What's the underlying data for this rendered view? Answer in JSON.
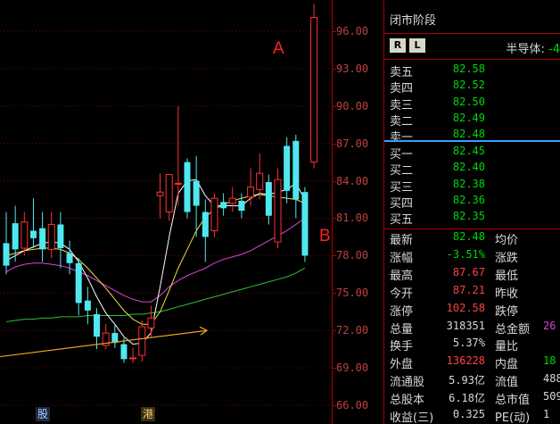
{
  "annotations": {
    "a": "A",
    "b": "B"
  },
  "axis": {
    "ticks": [
      "96.00",
      "93.00",
      "90.00",
      "87.00",
      "84.00",
      "81.00",
      "78.00",
      "75.00",
      "72.00",
      "69.00",
      "66.00"
    ]
  },
  "bottom_tags": {
    "left": "股",
    "right": "港"
  },
  "panel": {
    "title": "闭市阶段",
    "btn_r": "R",
    "btn_l": "L",
    "sector_name": "半导体:",
    "sector_change": "-4",
    "asks": [
      {
        "label": "卖五",
        "price": "82.58"
      },
      {
        "label": "卖四",
        "price": "82.52"
      },
      {
        "label": "卖三",
        "price": "82.50"
      },
      {
        "label": "卖二",
        "price": "82.49"
      },
      {
        "label": "卖一",
        "price": "82.48"
      }
    ],
    "bids": [
      {
        "label": "买一",
        "price": "82.45"
      },
      {
        "label": "买二",
        "price": "82.40"
      },
      {
        "label": "买三",
        "price": "82.38"
      },
      {
        "label": "买四",
        "price": "82.36"
      },
      {
        "label": "买五",
        "price": "82.35"
      }
    ],
    "stats": [
      {
        "l1": "最新",
        "v1": "82.48",
        "c1": "g",
        "l2": "均价",
        "v2": "",
        "c2": "w"
      },
      {
        "l1": "涨幅",
        "v1": "-3.51%",
        "c1": "g",
        "l2": "涨跌",
        "v2": "",
        "c2": "w"
      },
      {
        "l1": "最高",
        "v1": "87.67",
        "c1": "r",
        "l2": "最低",
        "v2": "",
        "c2": "w"
      },
      {
        "l1": "今开",
        "v1": "87.21",
        "c1": "r",
        "l2": "昨收",
        "v2": "",
        "c2": "w"
      },
      {
        "l1": "涨停",
        "v1": "102.58",
        "c1": "r",
        "l2": "跌停",
        "v2": "",
        "c2": "w"
      },
      {
        "l1": "总量",
        "v1": "318351",
        "c1": "w",
        "l2": "总金额",
        "v2": "26",
        "c2": "m"
      },
      {
        "l1": "换手",
        "v1": "5.37%",
        "c1": "w",
        "l2": "量比",
        "v2": "",
        "c2": "w"
      },
      {
        "l1": "外盘",
        "v1": "136228",
        "c1": "r",
        "l2": "内盘",
        "v2": "18",
        "c2": "g"
      },
      {
        "l1": "流通股",
        "v1": "5.93亿",
        "c1": "w",
        "l2": "流值",
        "v2": "488",
        "c2": "w"
      },
      {
        "l1": "总股本",
        "v1": "6.18亿",
        "c1": "w",
        "l2": "总市值",
        "v2": "509",
        "c2": "w"
      },
      {
        "l1": "收益(三)",
        "v1": "0.325",
        "c1": "w",
        "l2": "PE(动)",
        "v2": "1",
        "c2": "w"
      }
    ]
  },
  "chart_data": {
    "type": "candlestick",
    "ylim": [
      64.5,
      98.5
    ],
    "colors": {
      "up": "#ff3030",
      "down": "#50e8f0",
      "ma5": "#ffffff",
      "ma10": "#f0e040",
      "ma20": "#e040e0",
      "ma60": "#30c030",
      "trend_arrow": "#f0a020"
    },
    "candles": [
      {
        "o": 79.0,
        "c": 77.2,
        "h": 81.5,
        "l": 76.5
      },
      {
        "o": 80.6,
        "c": 78.5,
        "h": 82.0,
        "l": 77.5
      },
      {
        "o": 78.6,
        "c": 80.7,
        "h": 81.5,
        "l": 78.0
      },
      {
        "o": 80.0,
        "c": 79.4,
        "h": 82.6,
        "l": 78.6
      },
      {
        "o": 80.2,
        "c": 78.5,
        "h": 81.5,
        "l": 77.5
      },
      {
        "o": 78.5,
        "c": 80.5,
        "h": 81.5,
        "l": 77.8
      },
      {
        "o": 80.5,
        "c": 78.6,
        "h": 81.5,
        "l": 77.0
      },
      {
        "o": 78.2,
        "c": 77.4,
        "h": 79.2,
        "l": 76.5
      },
      {
        "o": 77.4,
        "c": 74.2,
        "h": 77.8,
        "l": 73.2
      },
      {
        "o": 74.4,
        "c": 73.6,
        "h": 75.5,
        "l": 72.5
      },
      {
        "o": 73.3,
        "c": 71.5,
        "h": 73.8,
        "l": 70.5
      },
      {
        "o": 70.8,
        "c": 71.8,
        "h": 72.5,
        "l": 70.5
      },
      {
        "o": 71.8,
        "c": 71.0,
        "h": 72.5,
        "l": 70.6
      },
      {
        "o": 70.9,
        "c": 69.7,
        "h": 71.4,
        "l": 69.4
      },
      {
        "o": 69.8,
        "c": 69.8,
        "h": 70.6,
        "l": 69.4
      },
      {
        "o": 70.0,
        "c": 72.3,
        "h": 72.8,
        "l": 69.5
      },
      {
        "o": 72.2,
        "c": 73.0,
        "h": 74.0,
        "l": 71.5
      },
      {
        "o": 82.8,
        "c": 83.1,
        "h": 84.6,
        "l": 81.0
      },
      {
        "o": 81.5,
        "c": 84.5,
        "h": 84.5,
        "l": 80.8
      },
      {
        "o": 83.8,
        "c": 83.8,
        "h": 90.0,
        "l": 82.0
      },
      {
        "o": 85.5,
        "c": 81.5,
        "h": 85.8,
        "l": 81.0
      },
      {
        "o": 84.0,
        "c": 82.0,
        "h": 86.0,
        "l": 79.5
      },
      {
        "o": 81.5,
        "c": 79.5,
        "h": 82.5,
        "l": 77.5
      },
      {
        "o": 80.0,
        "c": 82.6,
        "h": 83.0,
        "l": 79.5
      },
      {
        "o": 82.3,
        "c": 81.8,
        "h": 83.0,
        "l": 81.2
      },
      {
        "o": 82.2,
        "c": 82.6,
        "h": 83.5,
        "l": 81.5
      },
      {
        "o": 82.4,
        "c": 81.6,
        "h": 83.0,
        "l": 81.0
      },
      {
        "o": 82.7,
        "c": 83.5,
        "h": 85.0,
        "l": 82.0
      },
      {
        "o": 83.3,
        "c": 84.6,
        "h": 86.2,
        "l": 82.5
      },
      {
        "o": 83.9,
        "c": 81.2,
        "h": 84.5,
        "l": 80.5
      },
      {
        "o": 79.1,
        "c": 84.1,
        "h": 85.0,
        "l": 78.6
      },
      {
        "o": 86.8,
        "c": 83.2,
        "h": 87.5,
        "l": 82.2
      },
      {
        "o": 87.2,
        "c": 82.5,
        "h": 87.7,
        "l": 81.0
      },
      {
        "o": 83.1,
        "c": 78.0,
        "h": 83.5,
        "l": 77.5
      },
      {
        "o": 85.5,
        "c": 97.1,
        "h": 98.2,
        "l": 85.0
      }
    ],
    "ma5": [
      77.6,
      78.0,
      78.4,
      78.7,
      79.0,
      79.1,
      79.0,
      78.5,
      77.5,
      76.2,
      74.7,
      73.4,
      72.5,
      71.5,
      70.9,
      71.0,
      71.8,
      75.5,
      79.5,
      83.0,
      84.0,
      84.1,
      82.8,
      82.0,
      82.0,
      82.0,
      82.0,
      82.6,
      83.0,
      82.9,
      83.1,
      83.3,
      83.8,
      82.5
    ],
    "ma10": [
      78.0,
      78.2,
      78.4,
      78.5,
      78.6,
      78.6,
      78.5,
      78.2,
      77.7,
      77.0,
      76.2,
      75.4,
      74.5,
      73.6,
      72.9,
      72.5,
      72.5,
      73.5,
      75.2,
      77.0,
      78.5,
      80.0,
      81.1,
      81.7,
      82.1,
      82.4,
      82.6,
      82.8,
      82.9,
      82.8,
      82.7,
      82.6,
      82.5,
      82.2
    ],
    "ma20": [
      76.7,
      77.1,
      77.3,
      77.4,
      77.4,
      77.3,
      77.2,
      77.0,
      76.7,
      76.4,
      76.0,
      75.6,
      75.2,
      74.8,
      74.5,
      74.3,
      74.3,
      74.8,
      75.5,
      76.0,
      76.4,
      76.7,
      77.0,
      77.4,
      77.7,
      77.9,
      78.1,
      78.4,
      78.8,
      79.2,
      79.6,
      80.0,
      80.5,
      81.0
    ],
    "ma60": [
      72.7,
      72.8,
      72.9,
      72.9,
      73.0,
      73.0,
      73.1,
      73.1,
      73.1,
      73.2,
      73.2,
      73.2,
      73.2,
      73.2,
      73.3,
      73.3,
      73.4,
      73.5,
      73.7,
      73.9,
      74.1,
      74.3,
      74.5,
      74.7,
      74.9,
      75.1,
      75.3,
      75.5,
      75.7,
      75.9,
      76.1,
      76.3,
      76.6,
      77.0
    ],
    "trend_arrow": {
      "from": 69.9,
      "to": 72.0
    }
  }
}
